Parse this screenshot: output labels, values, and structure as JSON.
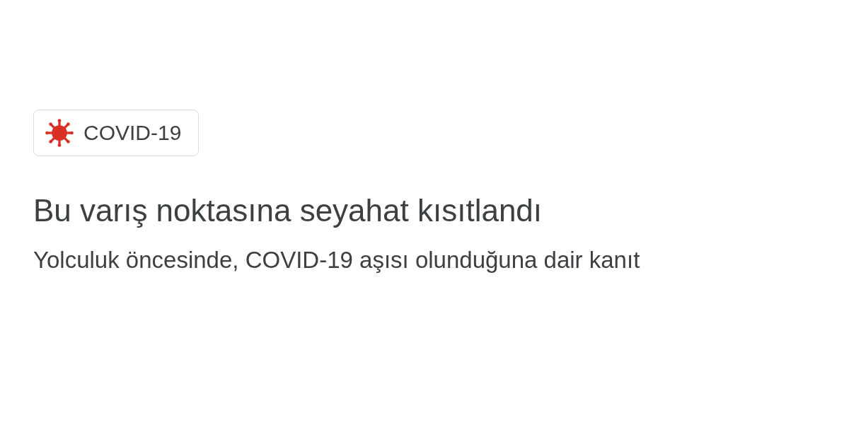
{
  "chip": {
    "label": "COVID-19"
  },
  "heading": "Bu varış noktasına seyahat kısıtlandı",
  "description": "Yolculuk öncesinde, COVID-19 aşısı olunduğuna dair kanıt"
}
